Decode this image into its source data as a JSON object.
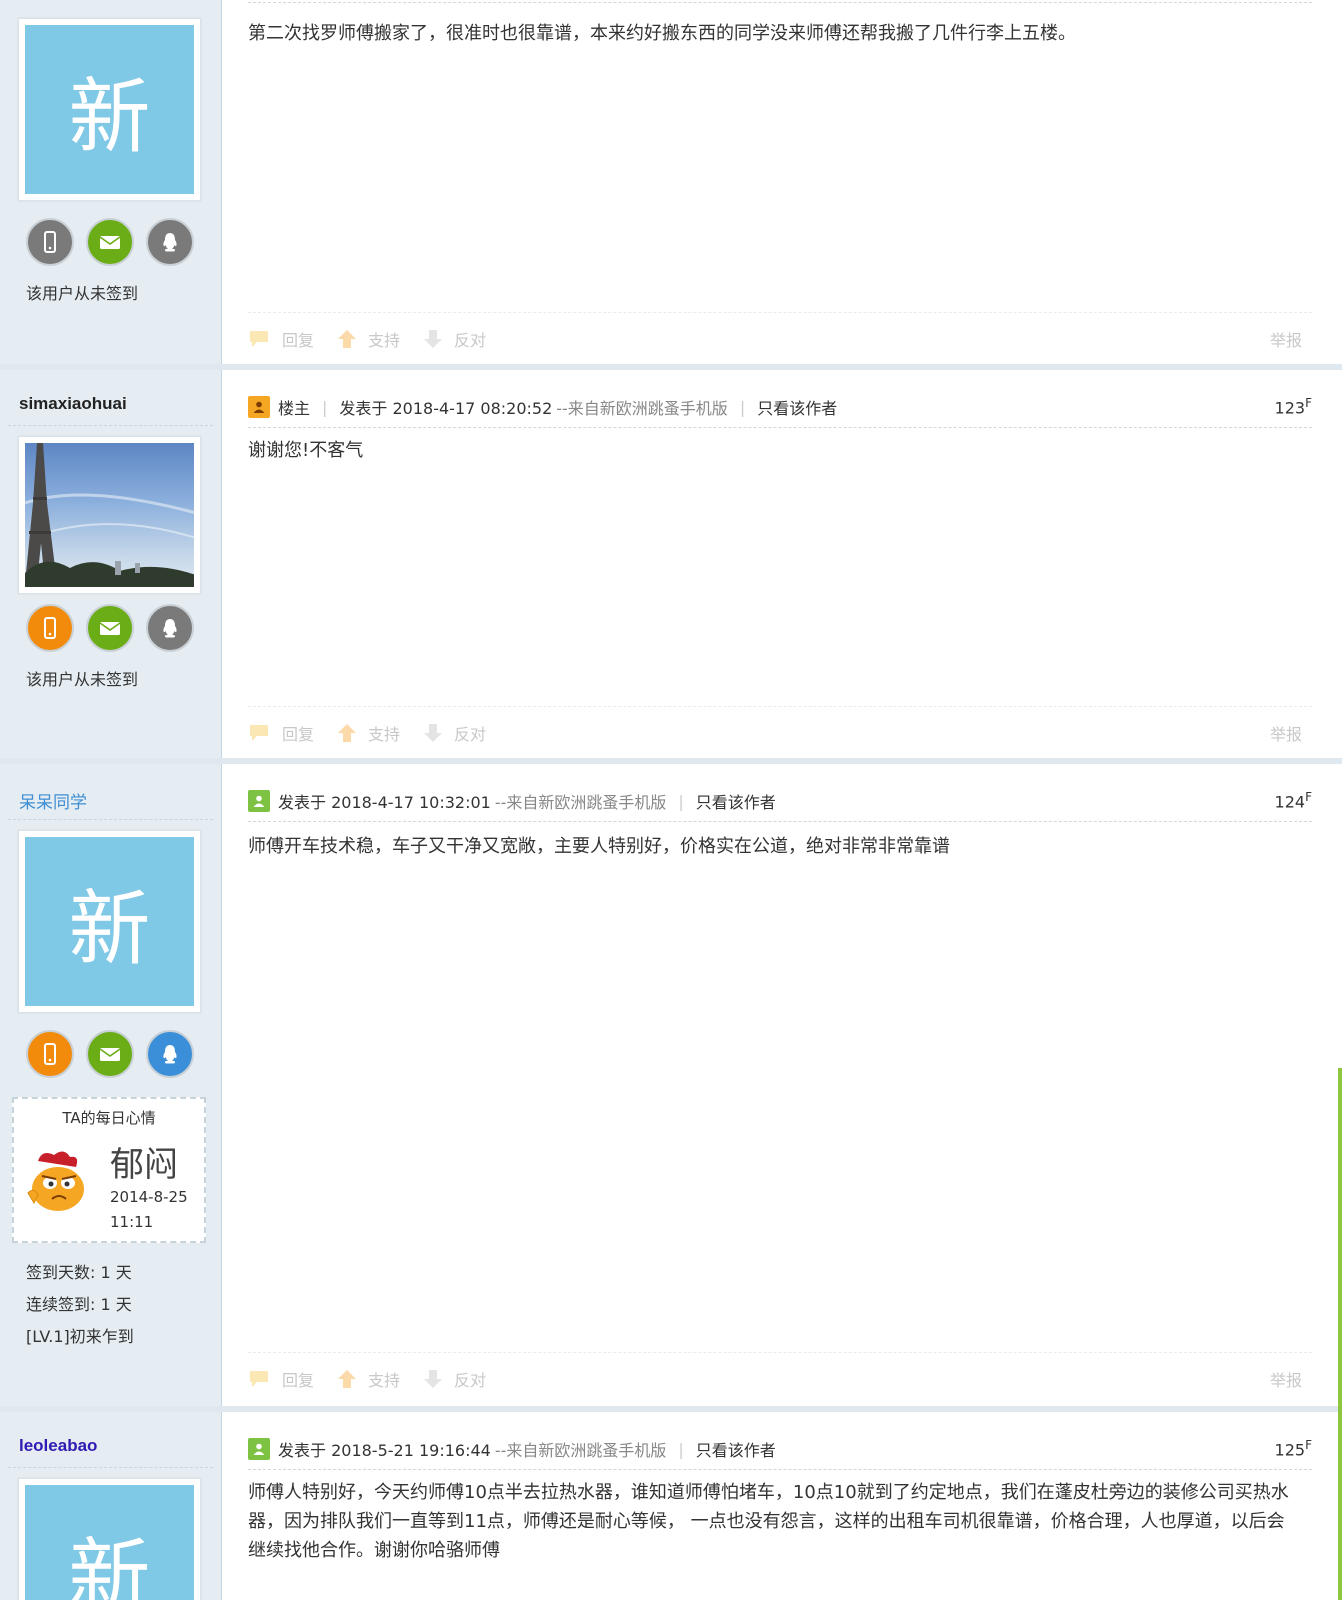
{
  "labels": {
    "reply": "回复",
    "support": "支持",
    "oppose": "反对",
    "report": "举报",
    "owner": "楼主",
    "only_author": "只看该作者",
    "from_app": "--来自新欧洲跳蚤手机版",
    "never_signed": "该用户从未签到",
    "avatar_new": "新"
  },
  "colors": {
    "sidebar_bg": "#e5edf2",
    "username_blue": "#3d8ed3",
    "username_purple": "#2f1bb3",
    "username_dark": "#222222"
  },
  "posts": [
    {
      "body": "第二次找罗师傅搬家了，很准时也很靠谱，本来约好搬东西的同学没来师傅还帮我搬了几件行李上五楼。",
      "icons": [
        "phone-icon-gray",
        "mail-icon-green",
        "qq-icon-gray"
      ]
    },
    {
      "username": "simaxiaohuai",
      "is_owner": true,
      "posted": "发表于 2018-4-17 08:20:52",
      "floor_num": "123",
      "floor_suffix": "F",
      "body": "谢谢您!不客气",
      "icons": [
        "phone-icon-orange",
        "mail-icon-green",
        "qq-icon-gray"
      ]
    },
    {
      "username": "呆呆同学",
      "posted": "发表于 2018-4-17 10:32:01",
      "floor_num": "124",
      "floor_suffix": "F",
      "body": "师傅开车技术稳，车子又干净又宽敞，主要人特别好，价格实在公道，绝对非常非常靠谱",
      "icons": [
        "phone-icon-orange",
        "mail-icon-green",
        "qq-icon-blue"
      ],
      "mood": {
        "title": "TA的每日心情",
        "word": "郁闷",
        "date": "2014-8-25 11:11"
      },
      "stats": {
        "days": "签到天数: 1 天",
        "streak": "连续签到: 1 天",
        "level": "[LV.1]初来乍到"
      }
    },
    {
      "username": "leoleabao",
      "posted": "发表于 2018-5-21 19:16:44",
      "floor_num": "125",
      "floor_suffix": "F",
      "body": "师傅人特别好，今天约师傅10点半去拉热水器，谁知道师傅怕堵车，10点10就到了约定地点，我们在蓬皮杜旁边的装修公司买热水器，因为排队我们一直等到11点，师傅还是耐心等候， 一点也没有怨言，这样的出租车司机很靠谱，价格合理，人也厚道，以后会继续找他合作。谢谢你哈骆师傅"
    }
  ]
}
